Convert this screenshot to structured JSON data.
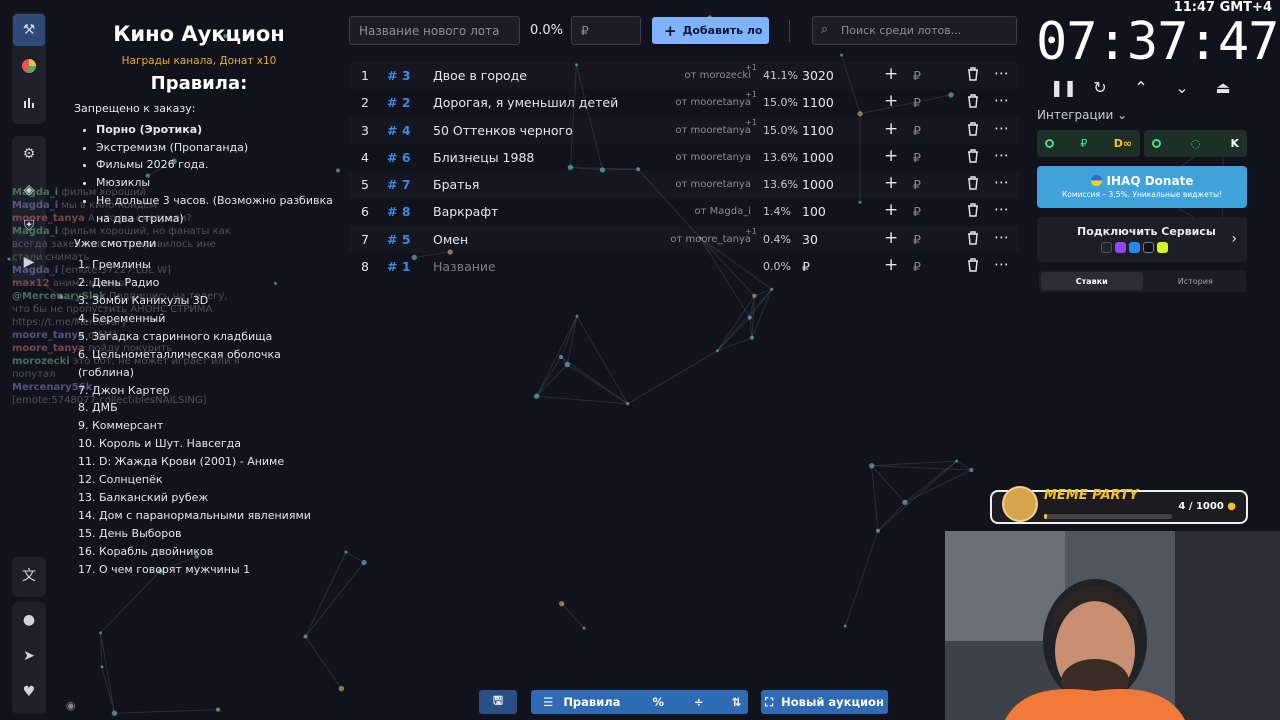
{
  "app": {
    "title": "Кино Аукцион",
    "subtitle": "Награды канала, Донат x10",
    "rules_heading": "Правила:",
    "banned_heading": "Запрещено к заказу:",
    "banned": [
      "Порно (Эротика)",
      "Экстремизм (Пропаганда)",
      "Фильмы 2026 года.",
      "Мюзиклы",
      "Не дольше 3 часов. (Возможно разбивка на два стрима)"
    ],
    "watched_heading": "Уже смотрели",
    "watched": [
      "1. Гремлины",
      "2. День Радио",
      "3. Зомби Каникулы 3D",
      "4. Беременный",
      "5. Загадка старинного кладбища",
      "6. Цельнометаллическая оболочка (гоблина)",
      "7. Джон Картер",
      "8. ДМБ",
      "9. Коммерсант",
      "10. Король и Шут. Навсегда",
      "11. D: Жажда Крови (2001) - Аниме",
      "12. Солнцепёк",
      "13. Балканский рубеж",
      "14. Дом с паранормальными явлениями",
      "15. День Выборов",
      "16. Корабль двойников",
      "17. О чем говорят мужчины 1"
    ]
  },
  "sidebar": {
    "icons": [
      "hammer-icon",
      "pie-chart-icon",
      "bar-chart-icon",
      "gear-icon",
      "layers-icon",
      "shield-icon",
      "youtube-icon",
      "translate-icon",
      "github-icon",
      "telegram-icon",
      "donate-hand-icon"
    ]
  },
  "chat": [
    {
      "user": "Magda_i",
      "text": "фильм хороший"
    },
    {
      "user": "Magda_i",
      "text": "мы в кино пойдём"
    },
    {
      "user": "moore_tanya",
      "text": "А что вы смотрели?"
    },
    {
      "user": "Magda_i",
      "text": "фильм хороший, но фанаты как всегда захейтили не понравилось ине стали снимать"
    },
    {
      "user": "Magda_i",
      "text": "[emote:37227:LUL W]"
    },
    {
      "user": "max12",
      "text": "аниме можно?"
    },
    {
      "user": "@MercenarySlek",
      "text": "Подпишись на телегу, что бы не пропустить АНОНС СТРИМА https://t.me/Mercenary"
    },
    {
      "user": "moore_tanya",
      "text": "oJAM]"
    },
    {
      "user": "moore_tanya",
      "text": "пойду покурить"
    },
    {
      "user": "morozecki",
      "text": "это бот, не может играет или я попутал"
    },
    {
      "user": "Mercenary56k",
      "text": "[emote:5748077:collectiblesNAILSING]"
    }
  ],
  "topbar": {
    "lot_placeholder": "Название нового лота",
    "percent": "0.0%",
    "amount_placeholder": "₽",
    "add_label": "Добавить ло",
    "search_placeholder": "Поиск среди лотов..."
  },
  "lots": [
    {
      "num": "1",
      "id": "# 3",
      "name": "Двое в городе",
      "from": "от morozecki",
      "sup": "+1",
      "pct": "41.1%",
      "amount": "3020"
    },
    {
      "num": "2",
      "id": "# 2",
      "name": "Дорогая, я уменьшил детей",
      "from": "от mooretanya",
      "sup": "+1",
      "pct": "15.0%",
      "amount": "1100"
    },
    {
      "num": "3",
      "id": "# 4",
      "name": "50 Оттенков черного",
      "from": "от mooretanya",
      "sup": "+1",
      "pct": "15.0%",
      "amount": "1100"
    },
    {
      "num": "4",
      "id": "# 6",
      "name": "Близнецы 1988",
      "from": "от mooretanya",
      "sup": "",
      "pct": "13.6%",
      "amount": "1000"
    },
    {
      "num": "5",
      "id": "# 7",
      "name": "Братья",
      "from": "от mooretanya",
      "sup": "",
      "pct": "13.6%",
      "amount": "1000"
    },
    {
      "num": "6",
      "id": "# 8",
      "name": "Варкрафт",
      "from": "от Magda_i",
      "sup": "",
      "pct": "1.4%",
      "amount": "100"
    },
    {
      "num": "7",
      "id": "# 5",
      "name": "Омен",
      "from": "от moore_tanya",
      "sup": "+1",
      "pct": "0.4%",
      "amount": "30"
    },
    {
      "num": "8",
      "id": "# 1",
      "name": "Название",
      "from": "",
      "sup": "",
      "pct": "0.0%",
      "amount": "₽"
    }
  ],
  "currency_symbol": "₽",
  "clock": {
    "time": "07:37:47",
    "label": "11:47 GMT+4"
  },
  "integrations": {
    "label": "Интеграции",
    "donate_title": "IHAQ Donate",
    "donate_sub": "Комиссия – 3,5%. Уникальные виджеты!",
    "services_title": "Подключить Сервисы",
    "tabs": [
      "Ставки",
      "История"
    ]
  },
  "bottom": {
    "rules": "Правила",
    "new_auction": "Новый аукцион"
  },
  "meme": {
    "title": "MEME PARTY",
    "count": "4 / 1000",
    "progress": 0.004
  },
  "colors": {
    "accent": "#7fb3ff",
    "id": "#3d8be0",
    "donate": "#3fa2d8",
    "bottom_btn": "#2f6ab5",
    "subtitle": "#e2b22c"
  }
}
